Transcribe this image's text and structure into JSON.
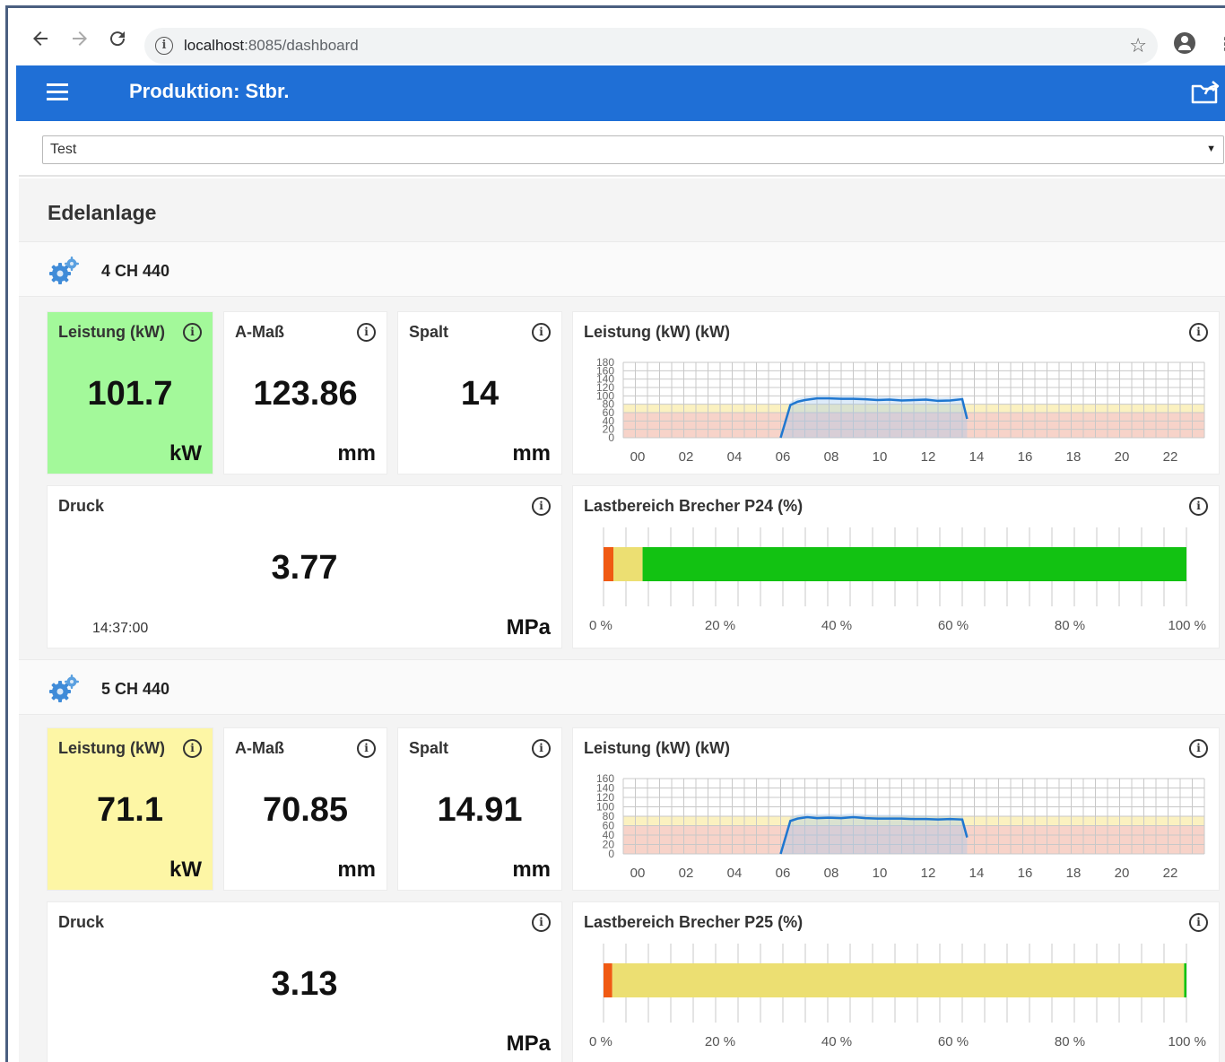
{
  "browser": {
    "url_host": "localhost",
    "url_path": ":8085/dashboard",
    "back_icon": "arrow-left-icon",
    "forward_icon": "arrow-right-icon",
    "reload_icon": "reload-icon"
  },
  "app": {
    "title": "Produktion: Stbr.",
    "accent_color": "#1f6fd6"
  },
  "selector": {
    "value": "Test"
  },
  "group": {
    "title": "Edelanlage"
  },
  "colors": {
    "green_tile": "#a3f99a",
    "yellow_tile": "#fdf6a5",
    "band_yellow": "#fbf1c0",
    "band_red": "#f7d3c9",
    "line": "#1f77d0",
    "bar_red": "#f05a13",
    "bar_yellow": "#ecdf72",
    "bar_green": "#12c212"
  },
  "machines": [
    {
      "name": "4 CH 440",
      "power_tile": {
        "title": "Leistung (kW)",
        "value": "101.7",
        "unit": "kW",
        "status": "green"
      },
      "amass_tile": {
        "title": "A-Maß",
        "value": "123.86",
        "unit": "mm"
      },
      "spalt_tile": {
        "title": "Spalt",
        "value": "14",
        "unit": "mm"
      },
      "druck_tile": {
        "title": "Druck",
        "value": "3.77",
        "unit": "MPa",
        "time": "14:37:00"
      },
      "trend_title": "Leistung (kW) (kW)",
      "load_title": "Lastbereich Brecher P24 (%)"
    },
    {
      "name": "5 CH 440",
      "power_tile": {
        "title": "Leistung (kW)",
        "value": "71.1",
        "unit": "kW",
        "status": "yellow"
      },
      "amass_tile": {
        "title": "A-Maß",
        "value": "70.85",
        "unit": "mm"
      },
      "spalt_tile": {
        "title": "Spalt",
        "value": "14.91",
        "unit": "mm"
      },
      "druck_tile": {
        "title": "Druck",
        "value": "3.13",
        "unit": "MPa",
        "time": ""
      },
      "trend_title": "Leistung (kW) (kW)",
      "load_title": "Lastbereich Brecher P25 (%)"
    }
  ],
  "chart_data": [
    {
      "type": "line",
      "title": "Leistung (kW) (kW)",
      "x_ticks": [
        "00",
        "02",
        "04",
        "06",
        "08",
        "10",
        "12",
        "14",
        "16",
        "18",
        "20",
        "22"
      ],
      "y_ticks": [
        "0",
        "20",
        "40",
        "60",
        "80",
        "100",
        "120",
        "140",
        "160",
        "180"
      ],
      "ylim": [
        0,
        180
      ],
      "xlim": [
        0,
        24
      ],
      "bands": [
        {
          "from": 0,
          "to": 60,
          "color": "red"
        },
        {
          "from": 60,
          "to": 80,
          "color": "yellow"
        }
      ],
      "series": [
        {
          "x": [
            6.5,
            6.9,
            7.2,
            7.5,
            8.0,
            8.5,
            9.0,
            9.5,
            10.0,
            10.5,
            11.0,
            11.5,
            12.0,
            12.5,
            13.0,
            13.5,
            14.0,
            14.2
          ],
          "y": [
            0,
            78,
            86,
            90,
            94,
            94,
            93,
            93,
            92,
            90,
            91,
            89,
            90,
            91,
            88,
            89,
            92,
            45
          ]
        }
      ]
    },
    {
      "type": "bar",
      "title": "Lastbereich Brecher P24 (%)",
      "x_ticks": [
        "0 %",
        "20 %",
        "40 %",
        "60 %",
        "80 %",
        "100 %"
      ],
      "xlim": [
        0,
        100
      ],
      "segments": [
        {
          "from": 0,
          "to": 1.7,
          "color": "red"
        },
        {
          "from": 1.7,
          "to": 6.7,
          "color": "yellow"
        },
        {
          "from": 6.7,
          "to": 100,
          "color": "green"
        }
      ]
    },
    {
      "type": "line",
      "title": "Leistung (kW) (kW)",
      "x_ticks": [
        "00",
        "02",
        "04",
        "06",
        "08",
        "10",
        "12",
        "14",
        "16",
        "18",
        "20",
        "22"
      ],
      "y_ticks": [
        "0",
        "20",
        "40",
        "60",
        "80",
        "100",
        "120",
        "140",
        "160"
      ],
      "ylim": [
        0,
        160
      ],
      "xlim": [
        0,
        24
      ],
      "bands": [
        {
          "from": 0,
          "to": 60,
          "color": "red"
        },
        {
          "from": 60,
          "to": 80,
          "color": "yellow"
        }
      ],
      "series": [
        {
          "x": [
            6.5,
            6.9,
            7.2,
            7.6,
            8.0,
            8.5,
            9.0,
            9.5,
            10.0,
            10.5,
            11.0,
            11.5,
            12.0,
            12.5,
            13.0,
            13.5,
            14.0,
            14.2
          ],
          "y": [
            0,
            70,
            75,
            78,
            76,
            77,
            76,
            78,
            76,
            75,
            75,
            75,
            74,
            74,
            73,
            74,
            73,
            35
          ]
        }
      ]
    },
    {
      "type": "bar",
      "title": "Lastbereich Brecher P25 (%)",
      "x_ticks": [
        "0 %",
        "20 %",
        "40 %",
        "60 %",
        "80 %",
        "100 %"
      ],
      "xlim": [
        0,
        100
      ],
      "segments": [
        {
          "from": 0,
          "to": 1.5,
          "color": "red"
        },
        {
          "from": 1.5,
          "to": 99.6,
          "color": "yellow"
        },
        {
          "from": 99.6,
          "to": 100,
          "color": "green"
        }
      ]
    }
  ]
}
